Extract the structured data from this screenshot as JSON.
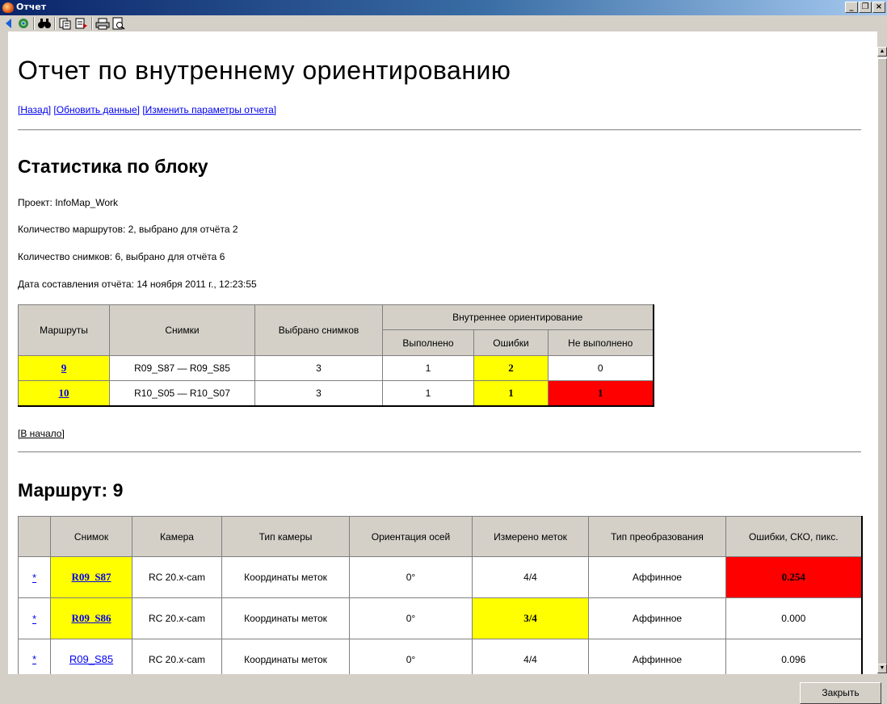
{
  "window": {
    "title": "Отчет"
  },
  "page_title": "Отчет по внутреннему ориентированию",
  "nav_links": [
    "[Назад]",
    "[Обновить данные]",
    "[Изменить параметры отчета]"
  ],
  "block_stats": {
    "heading": "Статистика по блоку",
    "project": "Проект: InfoMap_Work",
    "routes_count": "Количество маршрутов: 2, выбрано для отчёта 2",
    "images_count": "Количество снимков: 6, выбрано для отчёта 6",
    "report_date": "Дата составления отчёта: 14 ноября 2011 г., 12:23:55",
    "table": {
      "headers": {
        "routes": "Маршруты",
        "images": "Снимки",
        "selected": "Выбрано снимков",
        "io_group": "Внутреннее ориентирование",
        "done": "Выполнено",
        "errors": "Ошибки",
        "not_done": "Не выполнено"
      },
      "rows": [
        {
          "route": "9",
          "images": "R09_S87 — R09_S85",
          "selected": "3",
          "done": "1",
          "errors": "2",
          "not_done": "0"
        },
        {
          "route": "10",
          "images": "R10_S05 — R10_S07",
          "selected": "3",
          "done": "1",
          "errors": "1",
          "not_done": "1"
        }
      ]
    },
    "to_top": "[В начало]"
  },
  "route_section": {
    "heading": "Маршрут: 9",
    "table": {
      "headers": {
        "blank": "",
        "image": "Снимок",
        "camera": "Камера",
        "camera_type": "Тип камеры",
        "axes_orientation": "Ориентация осей",
        "measured": "Измерено меток",
        "transform_type": "Тип преобразования",
        "errors_rms": "Ошибки, СКО, пикс."
      },
      "rows": [
        {
          "mark": "*",
          "image": "R09_S87",
          "camera": "RC 20.x-cam",
          "camera_type": "Координаты меток",
          "axes": "0°",
          "measured": "4/4",
          "transform": "Аффинное",
          "error": "0.254"
        },
        {
          "mark": "*",
          "image": "R09_S86",
          "camera": "RC 20.x-cam",
          "camera_type": "Координаты меток",
          "axes": "0°",
          "measured": "3/4",
          "transform": "Аффинное",
          "error": "0.000"
        },
        {
          "mark": "*",
          "image": "R09_S85",
          "camera": "RC 20.x-cam",
          "camera_type": "Координаты меток",
          "axes": "0°",
          "measured": "4/4",
          "transform": "Аффинное",
          "error": "0.096"
        }
      ]
    }
  },
  "close_button": "Закрыть",
  "colors": {
    "warning": "#ffff00",
    "error": "#ff0000",
    "link": "#0000ee",
    "titlebar": "#0a246a"
  },
  "icons": [
    "back-icon",
    "refresh-icon",
    "find-icon",
    "copy-icon",
    "export-icon",
    "print-icon",
    "print-preview-icon"
  ]
}
